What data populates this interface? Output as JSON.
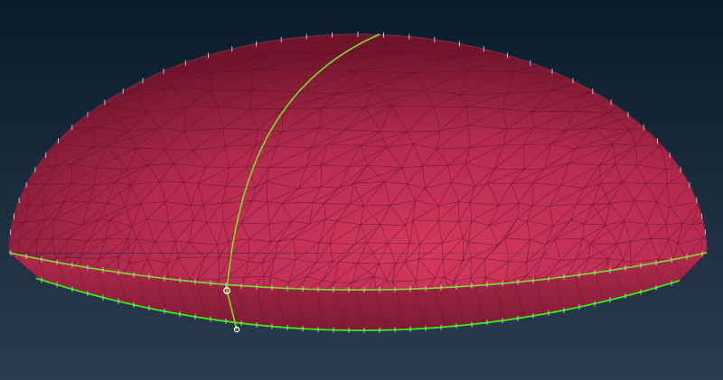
{
  "viewport": {
    "background_top": "#0a1c2b",
    "background_bottom": "#2a3c4e"
  },
  "model": {
    "surface_light": "#d5385e",
    "surface_mid": "#b52a4e",
    "surface_dark": "#70142c",
    "mesh_line": "#5a1024",
    "skirt_fill": "#9c2644"
  },
  "curves": {
    "edge_color": "#7ddd2a",
    "bottom_edge_color": "#38ee10",
    "node_color": "#c9d0e0",
    "vertex_color": "#ffffff"
  },
  "icons": {
    "vertex_marker": "circle-marker-icon"
  }
}
